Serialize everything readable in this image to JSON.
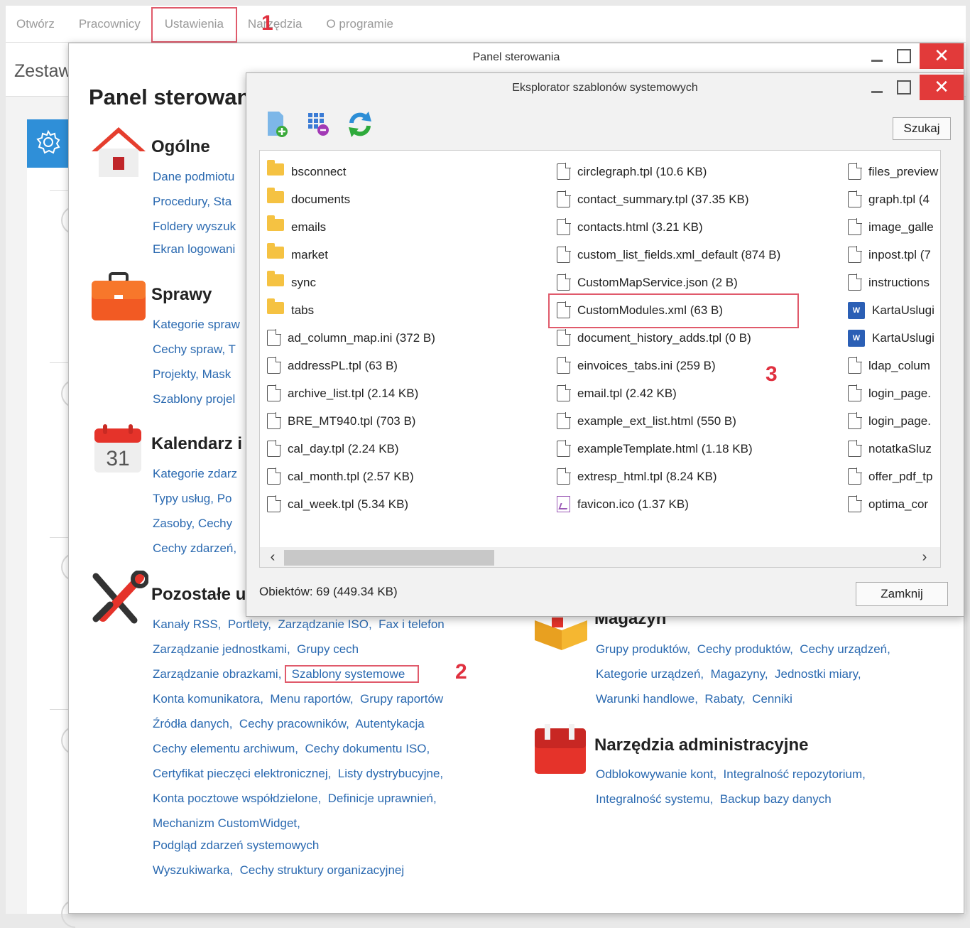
{
  "menu": {
    "items": [
      "Otwórz",
      "Pracownicy",
      "Ustawienia",
      "Narzędzia",
      "O programie"
    ]
  },
  "markers": {
    "m1": "1",
    "m2": "2",
    "m3": "3"
  },
  "app": {
    "title": "Zestaw"
  },
  "panel": {
    "window_title": "Panel sterowania",
    "heading": "Panel sterowania",
    "close_glyph": "✕",
    "sections": {
      "ogolne": {
        "title": "Ogólne",
        "lines": [
          "Dane podmiotu",
          "Procedury,  Sta",
          "Foldery wyszuk",
          "Ekran logowani"
        ]
      },
      "sprawy": {
        "title": "Sprawy",
        "lines": [
          "Kategorie spraw",
          "Cechy spraw,  T",
          "Projekty,  Mask",
          "Szablony projel"
        ]
      },
      "kalendarz": {
        "title": "Kalendarz i",
        "icon_day": "31",
        "lines": [
          "Kategorie zdarz",
          "Typy usług,  Po",
          "Zasoby,  Cechy",
          "Cechy zdarzeń,"
        ]
      },
      "pozostale": {
        "title": "Pozostałe u",
        "line1": [
          "Kanały RSS,",
          "Portlety,",
          "Zarządzanie ISO,",
          "Fax i telefon"
        ],
        "line2": [
          "Zarządzanie jednostkami,",
          "Grupy cech"
        ],
        "line3a": "Zarządzanie obrazkami,",
        "line3b": "Szablony systemowe",
        "line4": [
          "Konta komunikatora,",
          "Menu raportów,",
          "Grupy raportów"
        ],
        "line5": [
          "Źródła danych,",
          "Cechy pracowników,",
          "Autentykacja"
        ],
        "line6": [
          "Cechy elementu archiwum,",
          "Cechy dokumentu ISO,"
        ],
        "line7": [
          "Certyfikat pieczęci elektronicznej,",
          "Listy dystrybucyjne,"
        ],
        "line8": [
          "Konta pocztowe współdzielone,",
          "Definicje uprawnień,"
        ],
        "line9": "Mechanizm CustomWidget,",
        "line10": "Podgląd zdarzeń systemowych",
        "line11": [
          "Wyszukiwarka,",
          "Cechy struktury organizacyjnej"
        ]
      },
      "magazyn": {
        "title": "Magazyn",
        "line1": [
          "Grupy produktów,",
          "Cechy produktów,",
          "Cechy urządzeń,"
        ],
        "line2": [
          "Kategorie urządzeń,",
          "Magazyny,",
          "Jednostki miary,"
        ],
        "line3": [
          "Warunki handlowe,",
          "Rabaty,",
          "Cenniki"
        ]
      },
      "narzedzia": {
        "title": "Narzędzia administracyjne",
        "line1": [
          "Odblokowywanie kont,",
          "Integralność repozytorium,"
        ],
        "line2": [
          "Integralność systemu,",
          "Backup bazy danych"
        ]
      }
    }
  },
  "dialog": {
    "title": "Eksplorator szablonów systemowych",
    "close_glyph": "✕",
    "search_label": "Szukaj",
    "close_label": "Zamknij",
    "status": "Obiektów: 69 (449.34 KB)",
    "scroll_left": "‹",
    "scroll_right": "›",
    "col1": [
      {
        "name": "bsconnect",
        "type": "folder"
      },
      {
        "name": "documents",
        "type": "folder"
      },
      {
        "name": "emails",
        "type": "folder"
      },
      {
        "name": "market",
        "type": "folder"
      },
      {
        "name": "sync",
        "type": "folder"
      },
      {
        "name": "tabs",
        "type": "folder"
      },
      {
        "name": "ad_column_map.ini (372 B)",
        "type": "file"
      },
      {
        "name": "addressPL.tpl (63 B)",
        "type": "file"
      },
      {
        "name": "archive_list.tpl (2.14 KB)",
        "type": "file"
      },
      {
        "name": "BRE_MT940.tpl (703 B)",
        "type": "file"
      },
      {
        "name": "cal_day.tpl (2.24 KB)",
        "type": "file"
      },
      {
        "name": "cal_month.tpl (2.57 KB)",
        "type": "file"
      },
      {
        "name": "cal_week.tpl (5.34 KB)",
        "type": "file"
      }
    ],
    "col2": [
      {
        "name": "circlegraph.tpl (10.6 KB)",
        "type": "file"
      },
      {
        "name": "contact_summary.tpl (37.35 KB)",
        "type": "file"
      },
      {
        "name": "contacts.html (3.21 KB)",
        "type": "file"
      },
      {
        "name": "custom_list_fields.xml_default (874 B)",
        "type": "file"
      },
      {
        "name": "CustomMapService.json (2 B)",
        "type": "file"
      },
      {
        "name": "CustomModules.xml (63 B)",
        "type": "file",
        "highlight": true
      },
      {
        "name": "document_history_adds.tpl (0 B)",
        "type": "file"
      },
      {
        "name": "einvoices_tabs.ini (259 B)",
        "type": "file"
      },
      {
        "name": "email.tpl (2.42 KB)",
        "type": "file"
      },
      {
        "name": "example_ext_list.html (550 B)",
        "type": "file"
      },
      {
        "name": "exampleTemplate.html (1.18 KB)",
        "type": "file"
      },
      {
        "name": "extresp_html.tpl (8.24 KB)",
        "type": "file"
      },
      {
        "name": "favicon.ico (1.37 KB)",
        "type": "image"
      }
    ],
    "col3": [
      {
        "name": "files_preview",
        "type": "file"
      },
      {
        "name": "graph.tpl (4",
        "type": "file"
      },
      {
        "name": "image_galle",
        "type": "file"
      },
      {
        "name": "inpost.tpl (7",
        "type": "file"
      },
      {
        "name": "instructions",
        "type": "file"
      },
      {
        "name": "KartaUslugi",
        "type": "word"
      },
      {
        "name": "KartaUslugi",
        "type": "word"
      },
      {
        "name": "ldap_colum",
        "type": "file"
      },
      {
        "name": "login_page.",
        "type": "file"
      },
      {
        "name": "login_page.",
        "type": "file"
      },
      {
        "name": "notatkaSluz",
        "type": "file"
      },
      {
        "name": "offer_pdf_tp",
        "type": "file"
      },
      {
        "name": "optima_cor",
        "type": "file"
      }
    ]
  }
}
